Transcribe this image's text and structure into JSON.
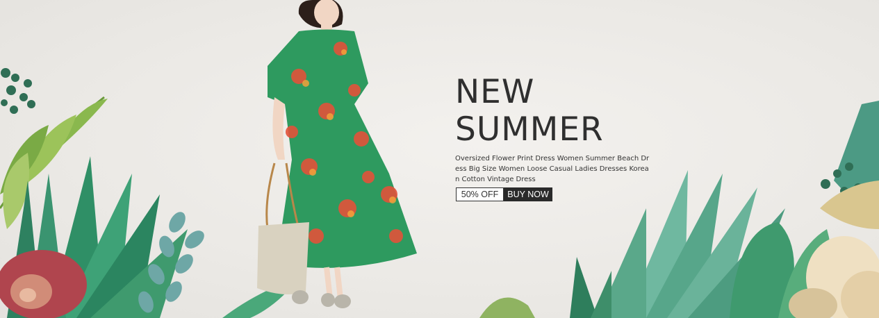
{
  "banner": {
    "headline_line1": "NEW",
    "headline_line2": "SUMMER",
    "description": "Oversized Flower Print Dress Women Summer Beach Dress Big Size Women Loose Casual Ladies Dresses Korean Cotton Vintage Dress",
    "discount_label": "50% OFF",
    "buy_label": "BUY NOW"
  },
  "colors": {
    "background": "#edebe7",
    "text": "#2f2f2f",
    "dress_green": "#2e9a5f",
    "dress_flower": "#e2523a",
    "leaf_green": "#3f9a6e",
    "button_dark": "#2a2a2a"
  },
  "images": {
    "model": "woman-in-green-floral-dress",
    "foliage": "watercolor-tropical-leaves"
  }
}
